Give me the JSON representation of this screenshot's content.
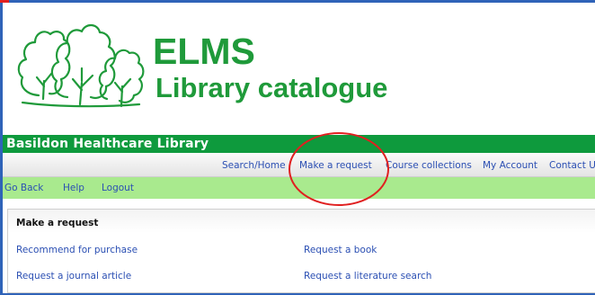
{
  "header": {
    "logo_icon": "trees-logo-icon",
    "title": "ELMS",
    "subtitle": "Library catalogue"
  },
  "library_bar": {
    "name": "Basildon Healthcare Library"
  },
  "top_nav": {
    "items": [
      {
        "label": "Search/Home"
      },
      {
        "label": "Make a request"
      },
      {
        "label": "Course collections"
      },
      {
        "label": "My Account"
      },
      {
        "label": "Contact U"
      }
    ]
  },
  "sub_nav": {
    "items": [
      {
        "label": "Go Back"
      },
      {
        "label": "Help"
      },
      {
        "label": "Logout"
      }
    ]
  },
  "request_panel": {
    "title": "Make a request",
    "links": [
      {
        "label": "Recommend for purchase"
      },
      {
        "label": "Request a book"
      },
      {
        "label": "Request a journal article"
      },
      {
        "label": "Request a literature search"
      }
    ]
  },
  "annotation": {
    "shape": "red-ellipse-highlight",
    "color": "#e02020"
  },
  "colors": {
    "brand_green": "#1f9a3a",
    "bar_green": "#0e9a3d",
    "subnav_green": "#a9ea8e",
    "link_blue": "#2b4fb3",
    "frame_blue": "#2f63b8"
  }
}
